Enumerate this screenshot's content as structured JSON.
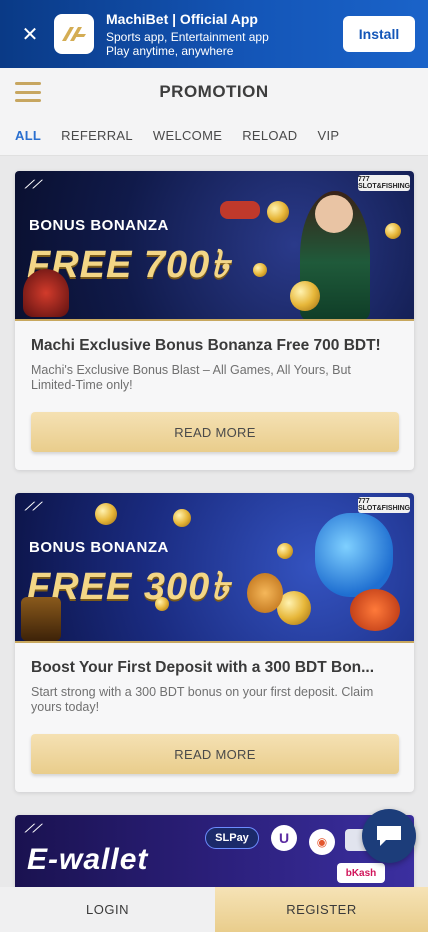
{
  "app_banner": {
    "close_icon": "close-icon",
    "title": "MachiBet | Official App",
    "subtitle_line1": "Sports app, Entertainment app",
    "subtitle_line2": "Play anytime, anywhere",
    "install_label": "Install",
    "background": "#1456b8"
  },
  "header": {
    "menu_icon": "hamburger-menu-icon",
    "title": "PROMOTION",
    "accent_color": "#c7a660"
  },
  "tabs": [
    {
      "label": "ALL",
      "active": true
    },
    {
      "label": "REFERRAL",
      "active": false
    },
    {
      "label": "WELCOME",
      "active": false
    },
    {
      "label": "RELOAD",
      "active": false
    },
    {
      "label": "VIP",
      "active": false
    }
  ],
  "promotions": [
    {
      "banner_subtitle": "BONUS BONANZA",
      "banner_headline": "FREE 700৳",
      "title": "Machi Exclusive Bonus Bonanza Free 700 BDT!",
      "description": "Machi's Exclusive Bonus Blast – All Games, All Yours, But Limited-Time only!",
      "button_label": "READ MORE"
    },
    {
      "banner_subtitle": "BONUS BONANZA",
      "banner_headline": "FREE 300৳",
      "title": "Boost Your First Deposit with a 300 BDT Bon...",
      "description": "Start strong with a 300 BDT bonus on your first deposit. Claim yours today!",
      "button_label": "READ MORE"
    },
    {
      "banner_headline": "E-wallet",
      "banner_logos": [
        "SLPay",
        "bKash"
      ]
    }
  ],
  "chat": {
    "icon": "chat-icon"
  },
  "bottom_bar": {
    "login_label": "LOGIN",
    "register_label": "REGISTER"
  },
  "colors": {
    "gold": "#e9cd8c",
    "tab_active": "#2a6fcf",
    "title_text": "#3a3a3a"
  }
}
